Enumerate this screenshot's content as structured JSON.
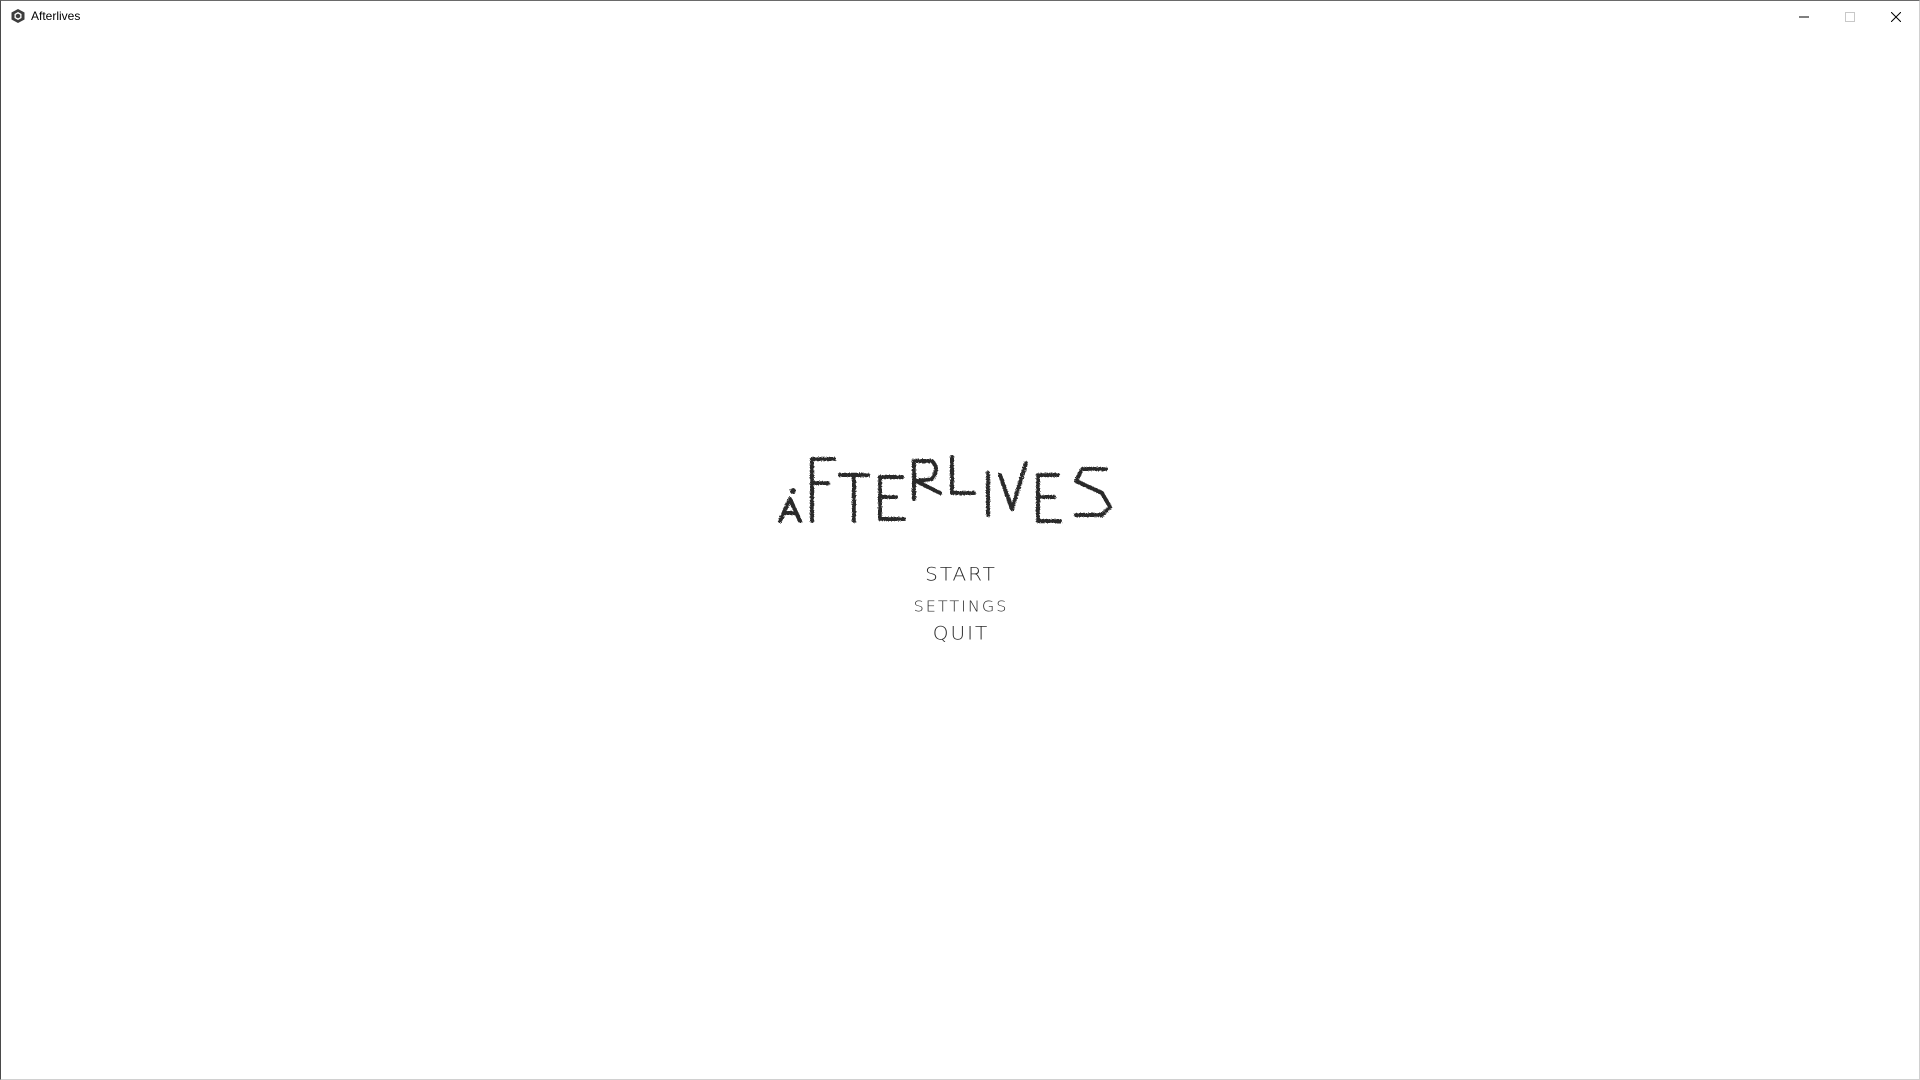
{
  "window": {
    "title": "Afterlives",
    "icon": "unity-cube-icon",
    "controls": {
      "minimize_icon": "minimize-icon",
      "maximize_icon": "maximize-icon",
      "close_icon": "close-icon"
    }
  },
  "game": {
    "title_logo": "AFTERLIVES",
    "menu": {
      "start": "START",
      "settings": "SETTINGS",
      "quit": "QUIT"
    }
  },
  "colors": {
    "background": "#ffffff",
    "text": "#2b2b2b"
  }
}
